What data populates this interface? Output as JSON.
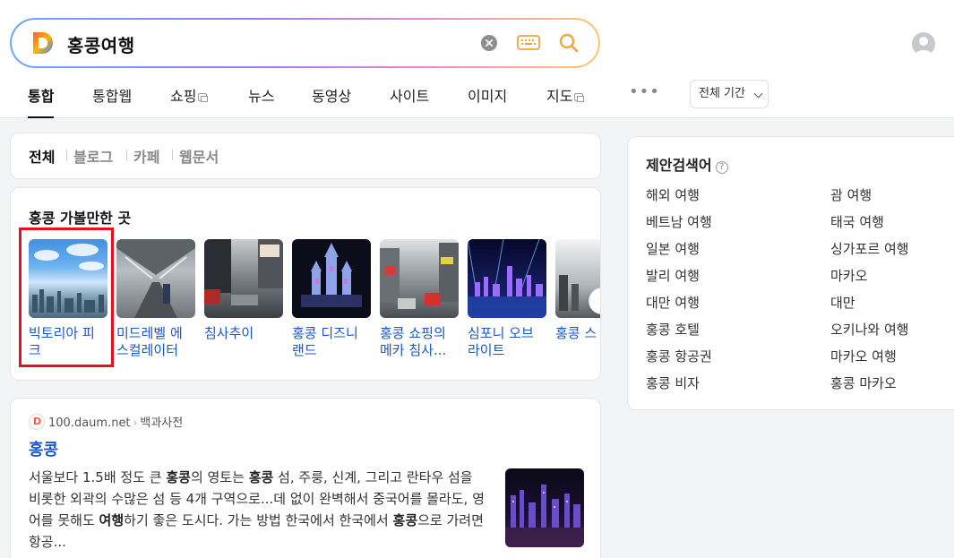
{
  "search": {
    "query": "홍콩여행"
  },
  "tabs": [
    {
      "label": "통합"
    },
    {
      "label": "통합웹"
    },
    {
      "label": "쇼핑"
    },
    {
      "label": "뉴스"
    },
    {
      "label": "동영상"
    },
    {
      "label": "사이트"
    },
    {
      "label": "이미지"
    },
    {
      "label": "지도"
    }
  ],
  "more": "•••",
  "period": {
    "label": "전체 기간"
  },
  "filters": [
    {
      "label": "전체"
    },
    {
      "label": "블로그"
    },
    {
      "label": "카페"
    },
    {
      "label": "웹문서"
    }
  ],
  "places": {
    "title": "홍콩 가볼만한 곳",
    "items": [
      {
        "label": "빅토리아 피크"
      },
      {
        "label": "미드레벨 에스컬레이터"
      },
      {
        "label": "침사추이"
      },
      {
        "label": "홍콩 디즈니랜드"
      },
      {
        "label": "홍콩 쇼핑의 메카 침사..."
      },
      {
        "label": "심포니 오브 라이트"
      },
      {
        "label": "홍콩 스"
      }
    ]
  },
  "dict": {
    "source": "100.daum.net",
    "category": "백과사전",
    "title": "홍콩",
    "body": [
      {
        "t": "서울보다 1.5배 정도 큰 ",
        "b": false
      },
      {
        "t": "홍콩",
        "b": true
      },
      {
        "t": "의 영토는 ",
        "b": false
      },
      {
        "t": "홍콩",
        "b": true
      },
      {
        "t": " 섬, 주룽, 신계, 그리고 란타우 섬을 비롯한 외곽의 수많은 섬 등 4개 구역으로...데 없이 완벽해서 중국어를 몰라도, 영어를 못해도 ",
        "b": false
      },
      {
        "t": "여행",
        "b": true
      },
      {
        "t": "하기 좋은 도시다. 가는 방법 한국에서 한국에서 ",
        "b": false
      },
      {
        "t": "홍콩",
        "b": true
      },
      {
        "t": "으로 가려면 항공...",
        "b": false
      }
    ]
  },
  "suggest": {
    "title": "제안검색어",
    "help": "?",
    "left": [
      "해외 여행",
      "베트남 여행",
      "일본 여행",
      "발리 여행",
      "대만 여행",
      "홍콩 호텔",
      "홍콩 항공권",
      "홍콩 비자"
    ],
    "right": [
      "괌 여행",
      "태국 여행",
      "싱가포르 여행",
      "마카오",
      "대만",
      "오키나와 여행",
      "마카오 여행",
      "홍콩 마카오"
    ]
  }
}
